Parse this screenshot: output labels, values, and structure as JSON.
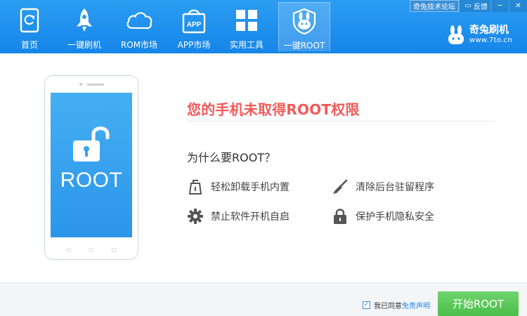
{
  "nav": {
    "items": [
      {
        "label": "首页",
        "icon": "home-phone-icon"
      },
      {
        "label": "一键刷机",
        "icon": "rocket-icon"
      },
      {
        "label": "ROM市场",
        "icon": "cloud-icon"
      },
      {
        "label": "APP市场",
        "icon": "app-bag-icon"
      },
      {
        "label": "实用工具",
        "icon": "grid-icon"
      },
      {
        "label": "一键ROOT",
        "icon": "rabbit-icon",
        "active": true
      }
    ]
  },
  "top_links": {
    "forum": "奇兔技术论坛",
    "feedback": "反馈",
    "minimize": "─",
    "close": "✕"
  },
  "brand": {
    "name": "奇兔刷机",
    "url": "www.7to.cn"
  },
  "phone": {
    "screen_text": "ROOT"
  },
  "content": {
    "warning_title": "您的手机未取得ROOT权限",
    "why_title": "为什么要ROOT？",
    "features": [
      {
        "label": "轻松卸载手机内置",
        "icon": "uninstall-icon"
      },
      {
        "label": "清除后台驻留程序",
        "icon": "broom-icon"
      },
      {
        "label": "禁止软件开机自启",
        "icon": "gear-icon"
      },
      {
        "label": "保护手机隐私安全",
        "icon": "lock-icon"
      }
    ]
  },
  "footer": {
    "agree_text": "我已同意",
    "agree_link": "免责声明",
    "agree_checked": true,
    "start_button": "开始ROOT"
  },
  "colors": {
    "header_blue": "#1685e9",
    "warning_red": "#f25a5a",
    "start_green": "#4cbf4a",
    "phone_screen_blue": "#2b95ea"
  }
}
